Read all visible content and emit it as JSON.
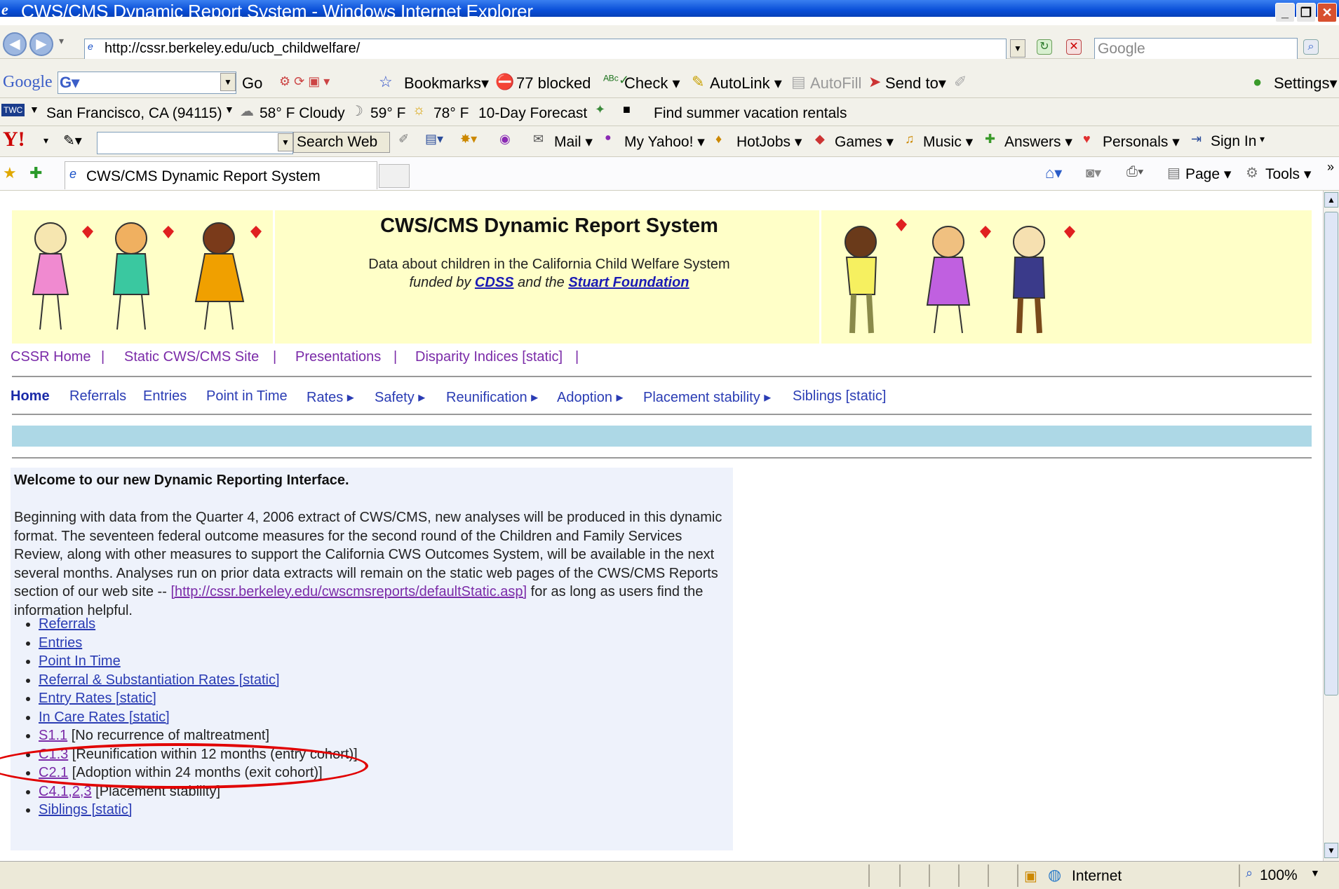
{
  "window": {
    "title": "CWS/CMS Dynamic Report System - Windows Internet Explorer"
  },
  "address_bar": {
    "url": "http://cssr.berkeley.edu/ucb_childwelfare/",
    "search_placeholder": "Google"
  },
  "google_toolbar": {
    "go_label": "Go",
    "bookmarks_label": "Bookmarks▾",
    "blocked_label": "77 blocked",
    "check_label": "Check ▾",
    "autolink_label": "AutoLink ▾",
    "autofill_label": "AutoFill",
    "sendto_label": "Send to▾",
    "settings_label": "Settings▾"
  },
  "weather_toolbar": {
    "location": "San Francisco, CA (94115)",
    "current": "58° F Cloudy",
    "low": "59° F",
    "high": "78° F",
    "forecast": "10-Day Forecast",
    "promo": "Find summer vacation rentals"
  },
  "yahoo_toolbar": {
    "search_web": "Search Web",
    "mail": "Mail ▾",
    "my_yahoo": "My Yahoo! ▾",
    "hotjobs": "HotJobs ▾",
    "games": "Games ▾",
    "music": "Music ▾",
    "answers": "Answers ▾",
    "personals": "Personals ▾",
    "sign_in": "Sign In"
  },
  "tabs": {
    "active": "CWS/CMS Dynamic Report System",
    "page_menu": "Page ▾",
    "tools_menu": "Tools ▾"
  },
  "page": {
    "header_title": "CWS/CMS Dynamic Report System",
    "subtitle": "Data about children in the California Child Welfare System",
    "funded_by": "funded by",
    "cdss": "CDSS",
    "and_the": "and the",
    "stuart": "Stuart Foundation",
    "top_nav": [
      "CSSR Home",
      "Static CWS/CMS Site",
      "Presentations",
      "Disparity Indices [static]"
    ],
    "main_nav": [
      "Home",
      "Referrals",
      "Entries",
      "Point in Time",
      "Rates ▸",
      "Safety ▸",
      "Reunification ▸",
      "Adoption ▸",
      "Placement stability ▸",
      "Siblings [static]"
    ],
    "welcome_heading": "Welcome to our new Dynamic Reporting Interface.",
    "intro_1": "Beginning with data from the Quarter 4, 2006 extract of CWS/CMS, new analyses will be produced in this dynamic format. The seventeen federal outcome measures for the second round of the Children and Family Services Review, along with other measures to support the California CWS Outcomes System, will be available in the next several months. Analyses run on prior data extracts will remain on the static web pages of the CWS/CMS Reports section of our web site -- ",
    "intro_link": "[http://cssr.berkeley.edu/cwscmsreports/defaultStatic.asp]",
    "intro_2": " for as long as users find the information helpful.",
    "links": [
      {
        "link": "Referrals",
        "rest": ""
      },
      {
        "link": "Entries",
        "rest": ""
      },
      {
        "link": "Point In Time",
        "rest": ""
      },
      {
        "link": "Referral & Substantiation Rates [static]",
        "rest": ""
      },
      {
        "link": "Entry Rates [static]",
        "rest": ""
      },
      {
        "link": "In Care Rates [static]",
        "rest": ""
      },
      {
        "link": "S1.1",
        "rest": " [No recurrence of maltreatment]"
      },
      {
        "link": "C1.3",
        "rest": " [Reunification within 12 months (entry cohort)]"
      },
      {
        "link": "C2.1",
        "rest": " [Adoption within 24 months (exit cohort)]"
      },
      {
        "link": "C4.1,2,3",
        "rest": " [Placement stability]"
      },
      {
        "link": "Siblings [static]",
        "rest": ""
      }
    ]
  },
  "statusbar": {
    "zone": "Internet",
    "zoom": "100%"
  },
  "colors": {
    "title_bar": "#0a4fd8",
    "banner_bg": "#ffffc8",
    "blue_bar": "#add8e6",
    "highlight_oval": "#e10000"
  }
}
